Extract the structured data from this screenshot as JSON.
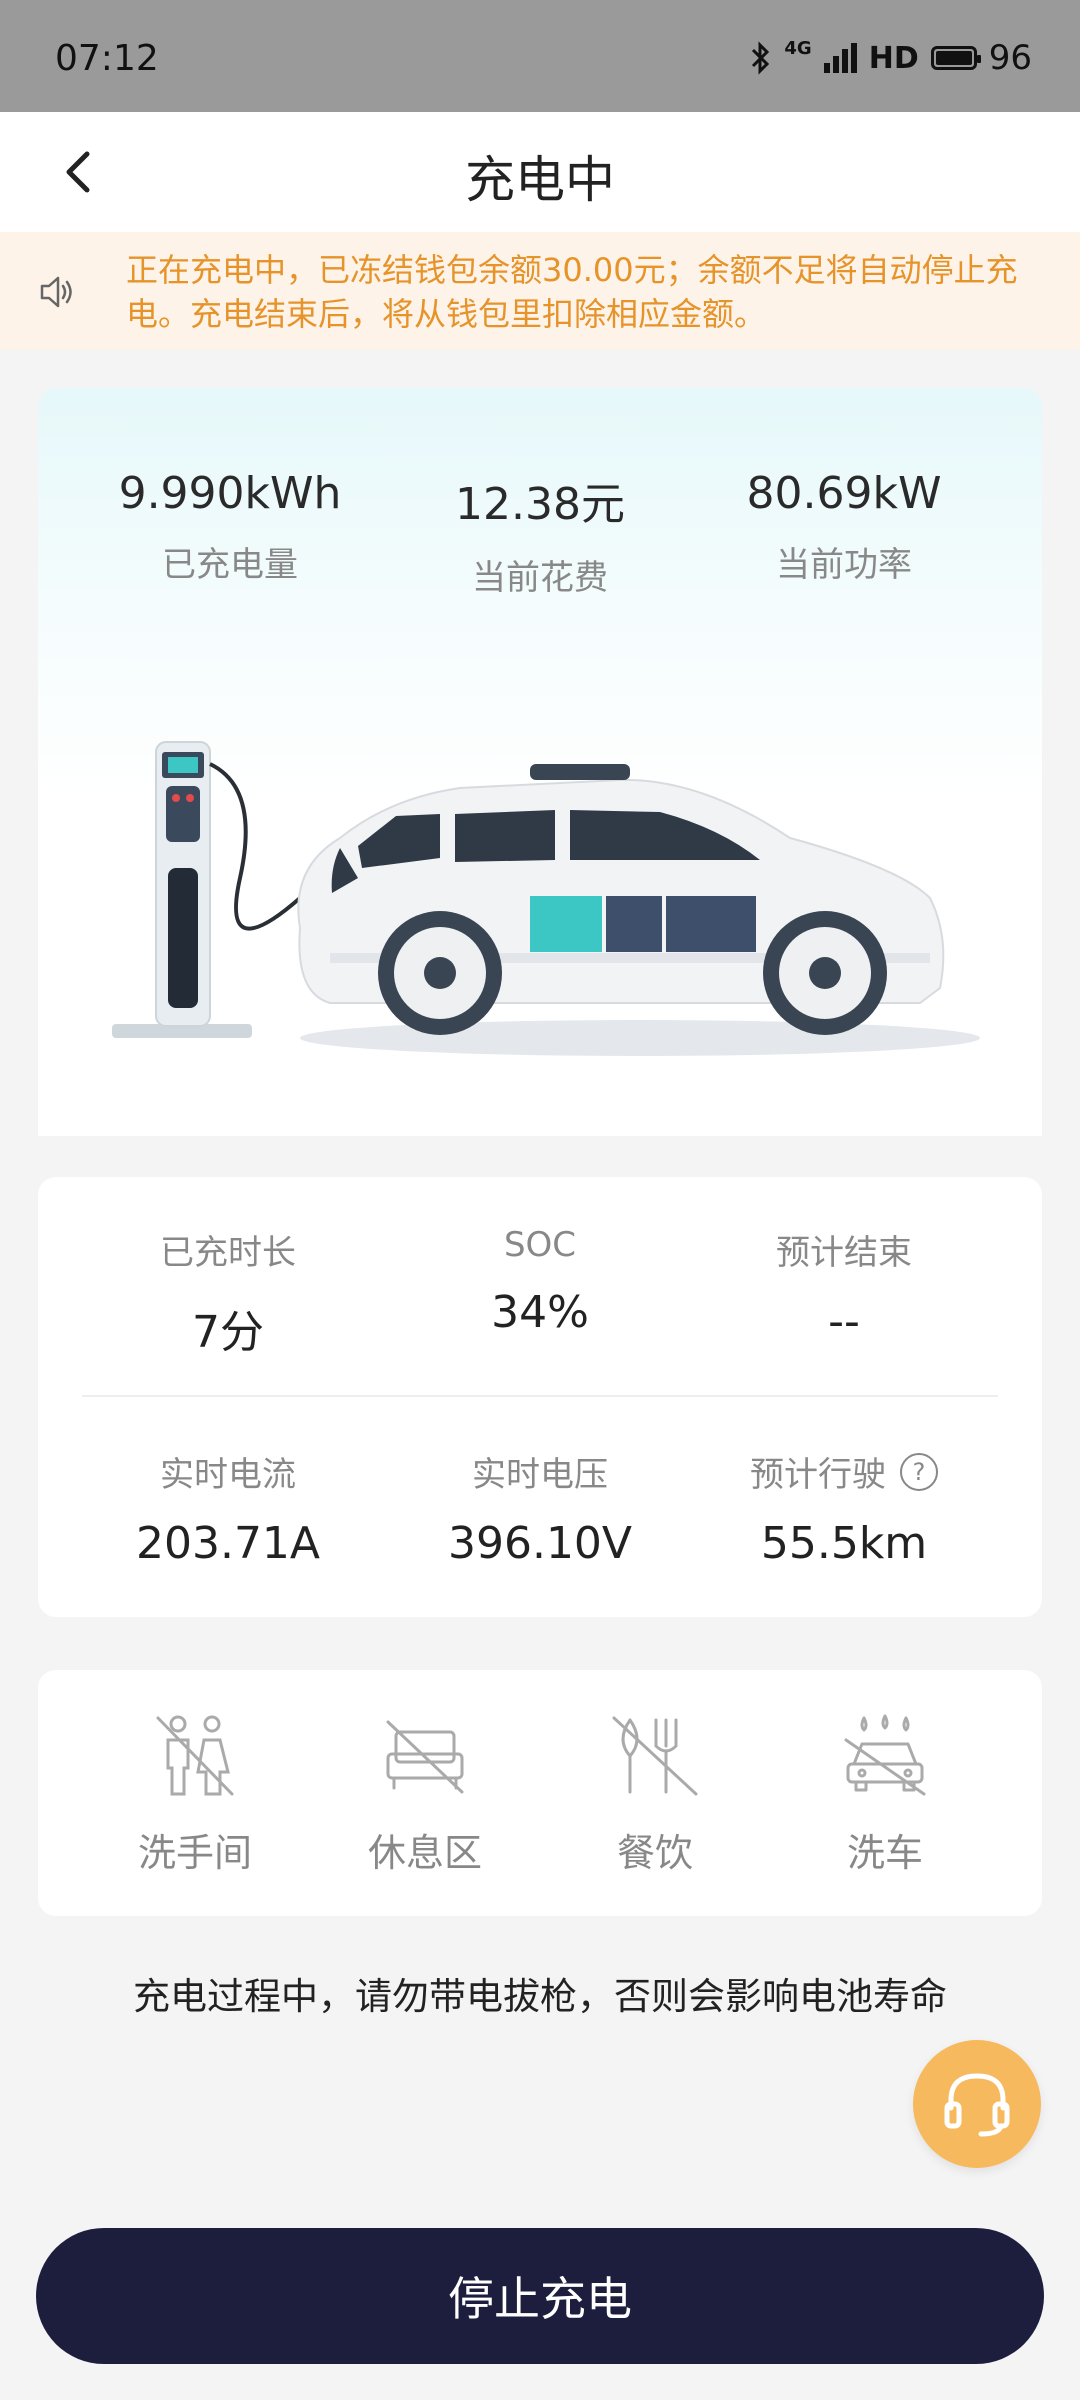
{
  "status_bar": {
    "time": "07:12",
    "network": "4G",
    "hd": "HD",
    "battery": "96",
    "icons": [
      "bluetooth-icon",
      "signal-icon",
      "battery-icon"
    ]
  },
  "header": {
    "title": "充电中",
    "back_icon": "chevron-left-icon"
  },
  "notice": {
    "icon": "speaker-icon",
    "text": "正在充电中，已冻结钱包余额30.00元；余额不足将自动停止充电。充电结束后，将从钱包里扣除相应金额。",
    "color": "#e6932a",
    "background": "#fdf3e8"
  },
  "summary": [
    {
      "value": "9.990kWh",
      "label": "已充电量"
    },
    {
      "value": "12.38元",
      "label": "当前花费"
    },
    {
      "value": "80.69kW",
      "label": "当前功率"
    }
  ],
  "illustration": {
    "name": "ev-charging-illustration",
    "battery_fill_color": "#3cc7c4",
    "battery_empty_color": "#3d4f6b"
  },
  "metrics": {
    "row1": [
      {
        "label": "已充时长",
        "value": "7分"
      },
      {
        "label": "SOC",
        "value": "34%"
      },
      {
        "label": "预计结束",
        "value": "--"
      }
    ],
    "row2": [
      {
        "label": "实时电流",
        "value": "203.71A"
      },
      {
        "label": "实时电压",
        "value": "396.10V"
      },
      {
        "label": "预计行驶",
        "value": "55.5km",
        "help": "?"
      }
    ]
  },
  "amenities": [
    {
      "label": "洗手间",
      "icon": "restroom-icon"
    },
    {
      "label": "休息区",
      "icon": "lounge-icon"
    },
    {
      "label": "餐饮",
      "icon": "dining-icon"
    },
    {
      "label": "洗车",
      "icon": "car-wash-icon"
    }
  ],
  "warning": "充电过程中，请勿带电拔枪，否则会影响电池寿命",
  "support_icon": "headset-icon",
  "stop_button": {
    "label": "停止充电",
    "color": "#1d1e3d"
  }
}
